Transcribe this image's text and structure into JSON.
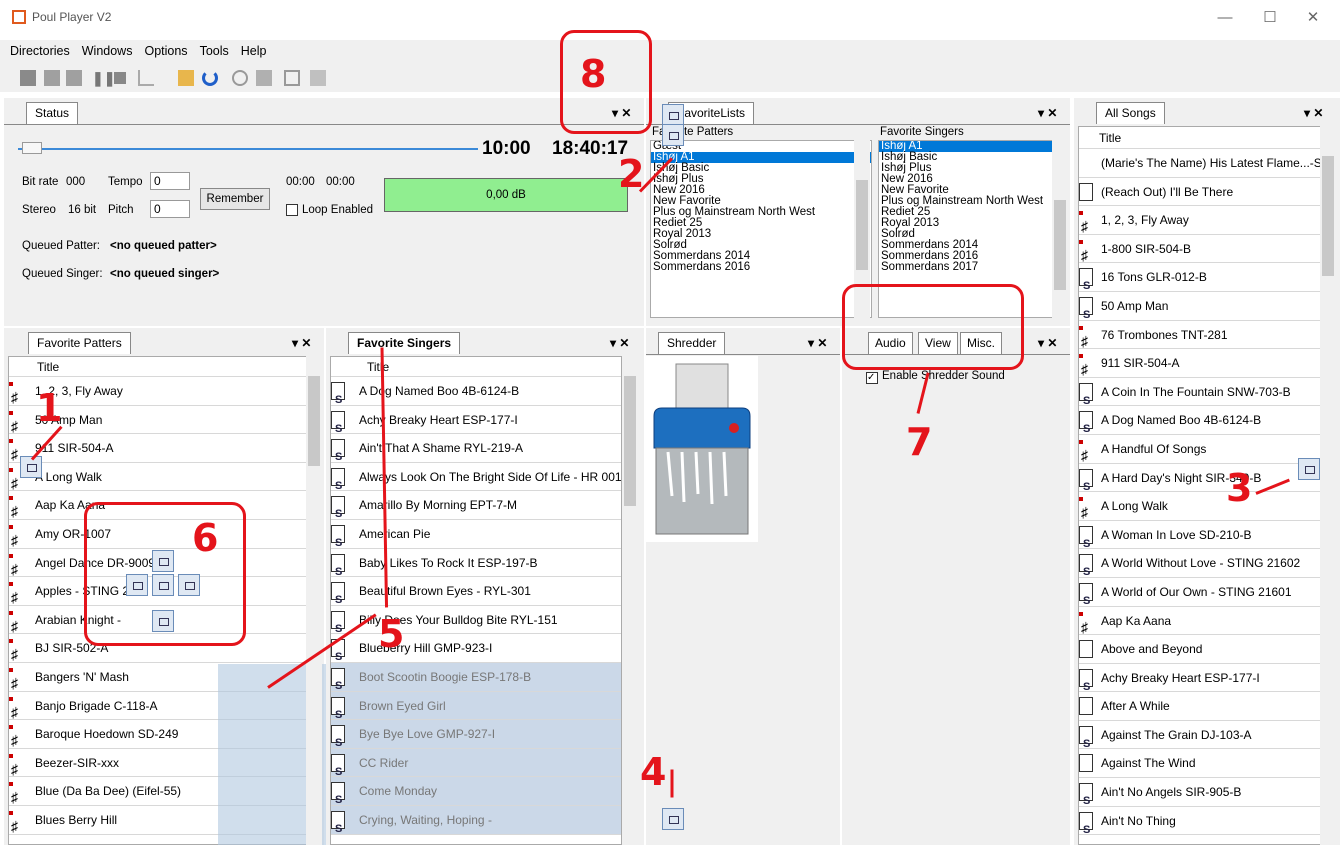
{
  "window": {
    "title": "Poul Player V2",
    "min": "—",
    "max": "☐",
    "close": "✕"
  },
  "menu": [
    "Directories",
    "Windows",
    "Options",
    "Tools",
    "Help"
  ],
  "status": {
    "tab": "Status",
    "time": "10:00",
    "clock": "18:40:17",
    "bitrate_label": "Bit rate",
    "bitrate_value": "000",
    "tempo_label": "Tempo",
    "tempo_value": "0",
    "stereo": "Stereo",
    "bits": "16 bit",
    "pitch_label": "Pitch",
    "pitch_value": "0",
    "remember": "Remember",
    "pos": "00:00",
    "len": "00:00",
    "loop": "Loop Enabled",
    "db": "0,00 dB",
    "queued_patter_label": "Queued Patter:",
    "queued_patter_value": "<no queued patter>",
    "queued_singer_label": "Queued Singer:",
    "queued_singer_value": "<no queued singer>"
  },
  "favlists": {
    "tab": "FavoriteLists",
    "patters_header": "Favorite Patters",
    "patters": [
      "Gæst",
      "Ishøj A1",
      "Ishøj Basic",
      "Ishøj Plus",
      "New 2016",
      "New Favorite",
      "Plus og Mainstream North West",
      "Rediet 25",
      "Royal 2013",
      "Solrød",
      "Sommerdans 2014",
      "Sommerdans 2016"
    ],
    "singers_header": "Favorite Singers",
    "singers": [
      "Ishøj A1",
      "Ishøj Basic",
      "Ishøj Plus",
      "New 2016",
      "New Favorite",
      "Plus og Mainstream North West",
      "Rediet 25",
      "Royal 2013",
      "Solrød",
      "Sommerdans 2014",
      "Sommerdans 2016",
      "Sommerdans 2017"
    ]
  },
  "allsongs": {
    "tab": "All Songs",
    "col": "Title",
    "rows": [
      {
        "t": "(Marie's The Name) His Latest Flame...-STIN",
        "i": "n"
      },
      {
        "t": "(Reach Out) I'll Be There",
        "i": "p"
      },
      {
        "t": "1, 2, 3, Fly Away",
        "i": "h"
      },
      {
        "t": "1-800 SIR-504-B",
        "i": "h"
      },
      {
        "t": "16 Tons GLR-012-B",
        "i": "s"
      },
      {
        "t": "50 Amp Man",
        "i": "s"
      },
      {
        "t": "76 Trombones TNT-281",
        "i": "h"
      },
      {
        "t": "911 SIR-504-A",
        "i": "h"
      },
      {
        "t": "A Coin In The Fountain SNW-703-B",
        "i": "s"
      },
      {
        "t": "A Dog Named Boo 4B-6124-B",
        "i": "s"
      },
      {
        "t": "A Handful Of Songs",
        "i": "h"
      },
      {
        "t": "A Hard Day's Night SIR-340-B",
        "i": "s"
      },
      {
        "t": "A Long Walk",
        "i": "h"
      },
      {
        "t": "A Woman In Love SD-210-B",
        "i": "s"
      },
      {
        "t": "A World Without Love - STING 21602",
        "i": "s"
      },
      {
        "t": "A World of Our Own - STING 21601",
        "i": "s"
      },
      {
        "t": "Aap Ka Aana",
        "i": "h"
      },
      {
        "t": "Above and Beyond",
        "i": "p"
      },
      {
        "t": "Achy Breaky Heart ESP-177-I",
        "i": "s"
      },
      {
        "t": "After A While",
        "i": "p"
      },
      {
        "t": "Against The Grain DJ-103-A",
        "i": "s"
      },
      {
        "t": "Against The Wind",
        "i": "p"
      },
      {
        "t": "Ain't No Angels SIR-905-B",
        "i": "s"
      },
      {
        "t": "Ain't No Thing",
        "i": "s"
      }
    ]
  },
  "patters": {
    "tab": "Favorite Patters",
    "col": "Title",
    "rows": [
      "1, 2, 3, Fly Away",
      "50 Amp Man",
      "911 SIR-504-A",
      "A Long Walk",
      "Aap Ka Aana",
      "Amy OR-1007",
      "Angel Dance DR-9009",
      "Apples - STING 2",
      "Arabian Knight -",
      "BJ SIR-502-A",
      "Bangers 'N' Mash",
      "Banjo Brigade C-118-A",
      "Baroque Hoedown SD-249",
      "Beezer-SIR-xxx",
      "Blue (Da Ba Dee) (Eifel-55)",
      "Blues Berry Hill"
    ]
  },
  "singers": {
    "tab": "Favorite Singers",
    "col": "Title",
    "rows": [
      "A Dog Named Boo 4B-6124-B",
      "Achy Breaky Heart ESP-177-I",
      "Ain't That A Shame RYL-219-A",
      "Always Look On The Bright Side Of Life - HR 001",
      "Amarillo By Morning EPT-7-M",
      "American Pie",
      "Baby Likes To Rock It ESP-197-B",
      "Beautiful Brown Eyes - RYL-301",
      "Billy Does Your Bulldog Bite RYL-151",
      "Blueberry Hill GMP-923-I",
      "Boot Scootin Boogie ESP-178-B",
      "Brown Eyed Girl",
      "Bye Bye Love GMP-927-I",
      "CC Rider",
      "Come Monday",
      "Crying, Waiting, Hoping -"
    ]
  },
  "shredder": {
    "tab": "Shredder"
  },
  "misc": {
    "tabs": [
      "Audio",
      "View",
      "Misc."
    ],
    "enable": "Enable Shredder Sound"
  },
  "annotations": [
    "1",
    "2",
    "3",
    "4",
    "5",
    "6",
    "7",
    "8"
  ]
}
